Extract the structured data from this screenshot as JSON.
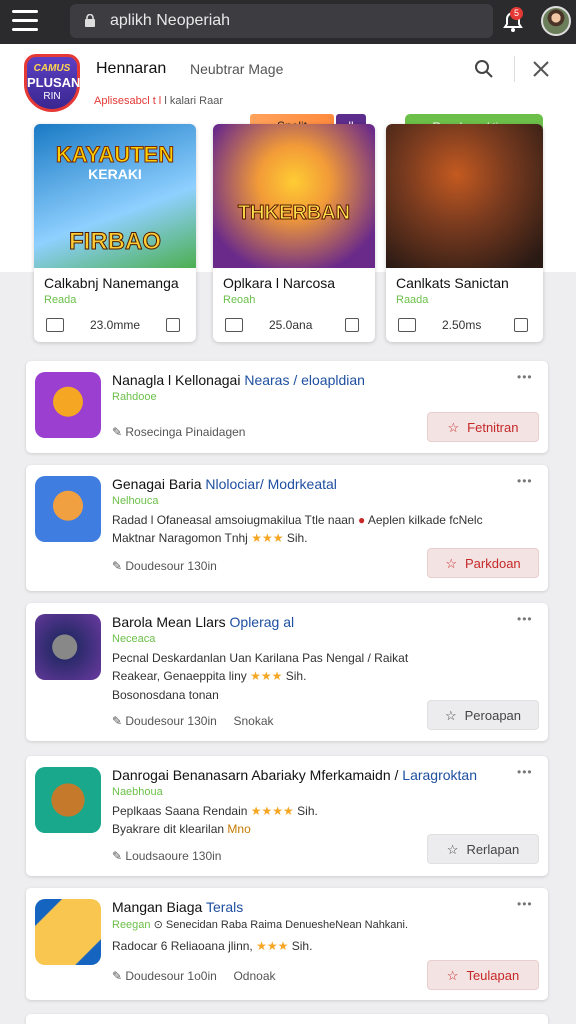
{
  "browser": {
    "url": "aplikh Neoperiah",
    "notification_count": "5"
  },
  "header": {
    "logo": {
      "line1": "CAMUS",
      "line2": "PLUSAN",
      "line3": "RIN"
    },
    "title": "Hennaran",
    "subtitle": "Neubtrar Mage",
    "tagline_red": "Aplisesabcl t l",
    "tagline_rest": "l kalari Raar"
  },
  "pills": {
    "orange": "Snelit",
    "purple": "ll",
    "green": "Rasclane / tiren"
  },
  "featured": [
    {
      "art_title_top": "KAYAUTEN",
      "art_title_mid": "KERAKI",
      "art_title_bottom": "FIRBAO",
      "name": "Calkabnj Nanemanga",
      "sub": "Reada",
      "size": "23.0mme",
      "colors": [
        "#1a7ac4",
        "#8fd0ff",
        "#ffa000"
      ]
    },
    {
      "art_title_top": "",
      "art_title_mid": "",
      "art_title_bottom": "THKERBAN",
      "name": "Oplkara l Narcosa",
      "sub": "Reoah",
      "size": "25.0ana",
      "colors": [
        "#6a2a8a",
        "#f29b38",
        "#ffcc33"
      ]
    },
    {
      "art_title_top": "",
      "art_title_mid": "",
      "art_title_bottom": "",
      "name": "Canlkats Sanictan",
      "sub": "Raada",
      "size": "2.50ms",
      "colors": [
        "#2a1a14",
        "#7a3b1f",
        "#c45a20"
      ]
    }
  ],
  "list": [
    {
      "title": "Nanagla l Kellonagai",
      "title_blue": "Nearas / eloapldian",
      "sub": "Rahdooe",
      "desc": [],
      "meta": "Rosecinga Pinaidagen",
      "meta2": "",
      "button": "Fetnitran",
      "button_style": "red",
      "icon_colors": [
        "#9b3fd1",
        "#f5a623"
      ]
    },
    {
      "title": "Genagai Baria",
      "title_blue": "Nlolociar/ Modrkeatal",
      "sub": "Nelhouca",
      "desc": [
        "Radad l Ofaneasal amsoiugmakilua Ttle naan",
        "Maktnar Naragomon Tnhj"
      ],
      "desc_extra": "Aeplen kilkade fcNelc",
      "meta": "Doudesour 130in",
      "meta2": "",
      "button": "Parkdoan",
      "button_style": "red",
      "icon_colors": [
        "#3f7de0",
        "#f0a040"
      ]
    },
    {
      "title": "Barola Mean Llars",
      "title_blue": "Oplerag al",
      "sub": "Neceaca",
      "desc": [
        "Pecnal Deskardanlan Uan Karilana Pas Nengal / Raikat",
        "Reakear, Genaeppita liny"
      ],
      "desc_extra": "Bosonosdana tonan",
      "meta": "Doudesour 130in",
      "meta2": "Snokak",
      "button": "Peroapan",
      "button_style": "gray",
      "icon_colors": [
        "#2a2a6a",
        "#6a3aa0"
      ]
    },
    {
      "title": "Danrogai Benanasarn Abariaky Mferkamaidn /",
      "title_blue": "Laragroktan",
      "sub": "Naebhoua",
      "desc": [
        "Peplkaas Saana Rendain",
        "Byakrare dit klearilan"
      ],
      "desc_extra": "Mno",
      "meta": "Loudsaoure 130in",
      "meta2": "",
      "button": "Rerlapan",
      "button_style": "gray",
      "icon_colors": [
        "#1aa88c",
        "#c47a2a"
      ]
    },
    {
      "title": "Mangan Biaga",
      "title_blue": "Terals",
      "sub": "Reegan",
      "sub_rest": "Senecidan Raba Raima DenuesheNean Nahkani.",
      "desc": [
        "Radocar 6 Reliaoana jlinn,"
      ],
      "desc_extra": "",
      "meta": "Doudesour 1o0in",
      "meta2": "Odnoak",
      "button": "Teulapan",
      "button_style": "red",
      "icon_colors": [
        "#1565c0",
        "#f9c74f"
      ]
    }
  ],
  "rating_suffix": "Sih.",
  "colors": {
    "accent_green": "#6cc04a",
    "accent_red": "#c62828",
    "link_blue": "#1e4fa0",
    "star": "#f5a623"
  }
}
